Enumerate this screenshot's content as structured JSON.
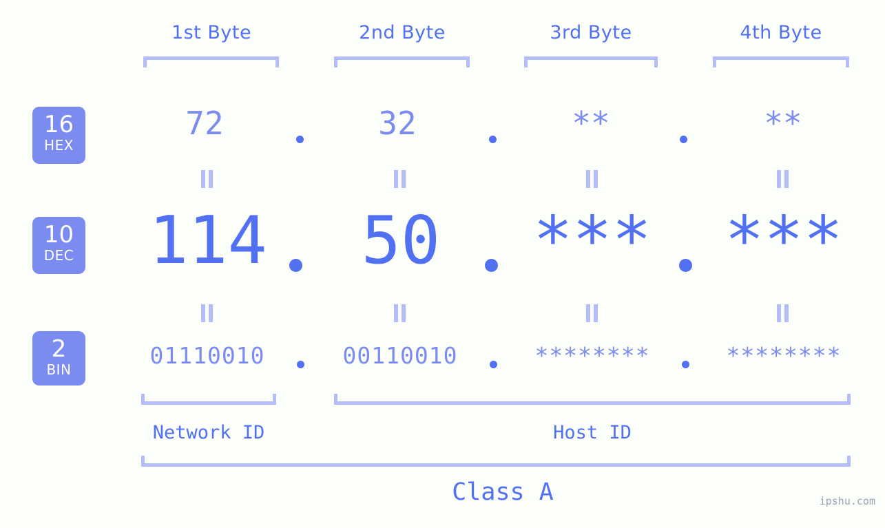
{
  "colors": {
    "background": "#fcfefa",
    "accent_strong": "#5271f2",
    "accent_mid": "#7b8bef",
    "accent_light": "#b4bdf7",
    "badge_bg": "#7b8bef",
    "badge_text": "#ffffff",
    "watermark": "#8d93a8"
  },
  "headers": {
    "bytes": [
      {
        "label": "1st Byte"
      },
      {
        "label": "2nd Byte"
      },
      {
        "label": "3rd Byte"
      },
      {
        "label": "4th Byte"
      }
    ]
  },
  "bases": [
    {
      "number": "16",
      "name": "HEX"
    },
    {
      "number": "10",
      "name": "DEC"
    },
    {
      "number": "2",
      "name": "BIN"
    }
  ],
  "rows": {
    "hex": {
      "values": [
        "72",
        "32",
        "**",
        "**"
      ]
    },
    "dec": {
      "values": [
        "114",
        "50",
        "***",
        "***"
      ]
    },
    "bin": {
      "values": [
        "01110010",
        "00110010",
        "********",
        "********"
      ]
    }
  },
  "separators": {
    "glyph": "."
  },
  "equals": {
    "glyph": "="
  },
  "footer": {
    "network_id_label": "Network ID",
    "host_id_label": "Host ID",
    "class_label": "Class A"
  },
  "watermark": {
    "text": "ipshu.com"
  }
}
